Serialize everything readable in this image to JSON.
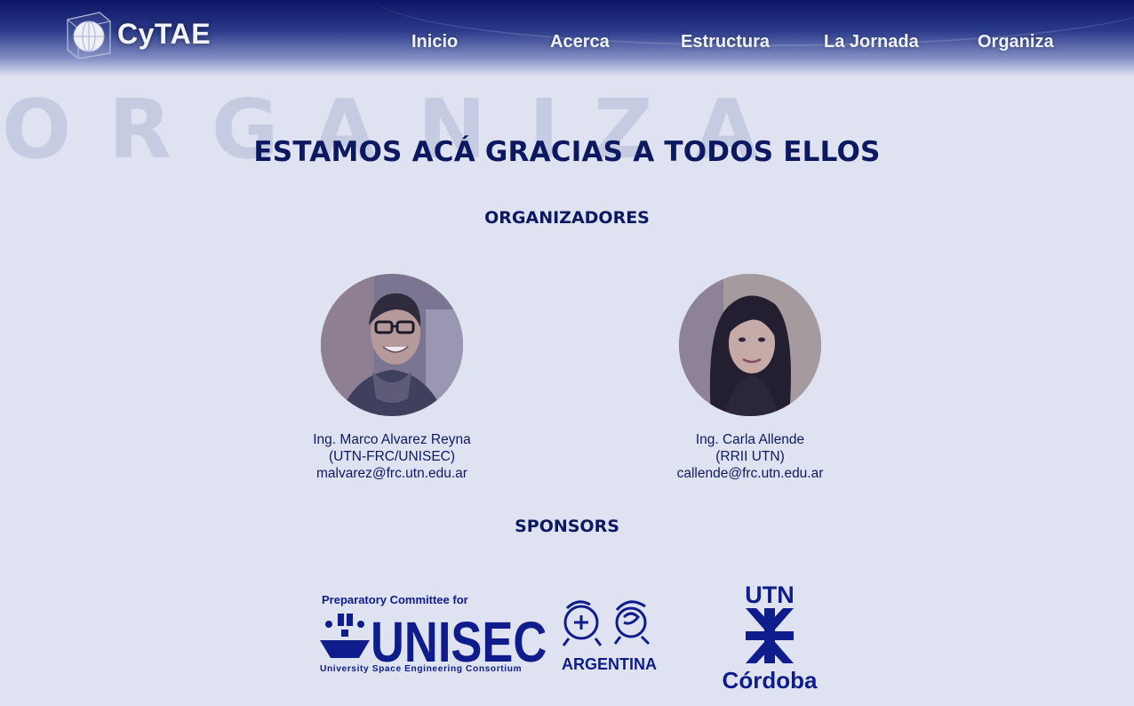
{
  "header": {
    "logo_text": "CyTAE",
    "nav": [
      "Inicio",
      "Acerca",
      "Estructura",
      "La Jornada",
      "Organiza"
    ]
  },
  "watermark_letters": [
    "O",
    "R",
    "G",
    "A",
    "N",
    "I",
    "Z",
    "A"
  ],
  "main_title": "ESTAMOS ACÁ GRACIAS A TODOS ELLOS",
  "organizers": {
    "title": "ORGANIZADORES",
    "people": [
      {
        "name": "Ing. Marco Alvarez Reyna",
        "affiliation": "(UTN-FRC/UNISEC)",
        "email": "malvarez@frc.utn.edu.ar"
      },
      {
        "name": "Ing. Carla Allende",
        "affiliation": "(RRII UTN)",
        "email": "callende@frc.utn.edu.ar"
      }
    ]
  },
  "sponsors": {
    "title": "SPONSORS",
    "unisec": {
      "top_text": "Preparatory Committee for",
      "main_text": "UNISEC",
      "sub_text": "University Space Engineering Consortium",
      "country": "ARGENTINA"
    },
    "utn": {
      "top_text": "UTN",
      "bottom_text": "Córdoba"
    }
  },
  "colors": {
    "header_dark": "#0c1565",
    "background": "#dfe2f0",
    "accent_navy": "#0c1860",
    "watermark": "#c5cbe1"
  }
}
